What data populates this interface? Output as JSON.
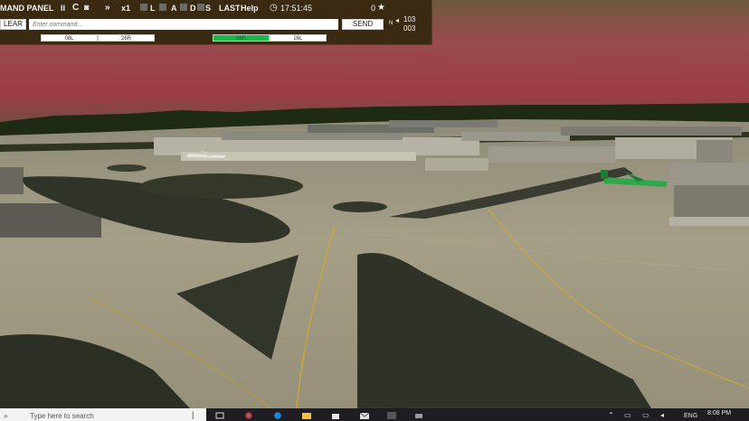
{
  "panel": {
    "title": "MAND PANEL",
    "pause_glyph": "II",
    "refresh_glyph": "C",
    "camera_glyph": "◙",
    "ffwd_glyph": "»",
    "speed": "x1",
    "filter_l1": "L",
    "filter_a": "A",
    "filter_d": "D",
    "filter_s": "S",
    "last": "LAST",
    "help": "Help",
    "clock_icon": "◷",
    "time": "17:51:45",
    "score": "0",
    "star_icon": "★",
    "clear_label": "LEAR",
    "command_placeholder": "Enter command...",
    "send_label": "SEND",
    "compass_n": "N",
    "compass_icon": "◂",
    "heading_top": "103",
    "heading_bottom": "003",
    "runways": [
      "08L",
      "26R",
      "08R",
      "26L"
    ],
    "active_runway": "08R",
    "active_color": "#1db84a"
  },
  "taskbar": {
    "search_placeholder": "Type here to search",
    "lang": "ENG",
    "time": "8:08 PM",
    "apps": [
      "task-view-icon",
      "chrome-icon",
      "edge-icon",
      "file-explorer-icon",
      "store-icon",
      "mail-icon",
      "game-app-icon",
      "extra-app-icon"
    ]
  }
}
